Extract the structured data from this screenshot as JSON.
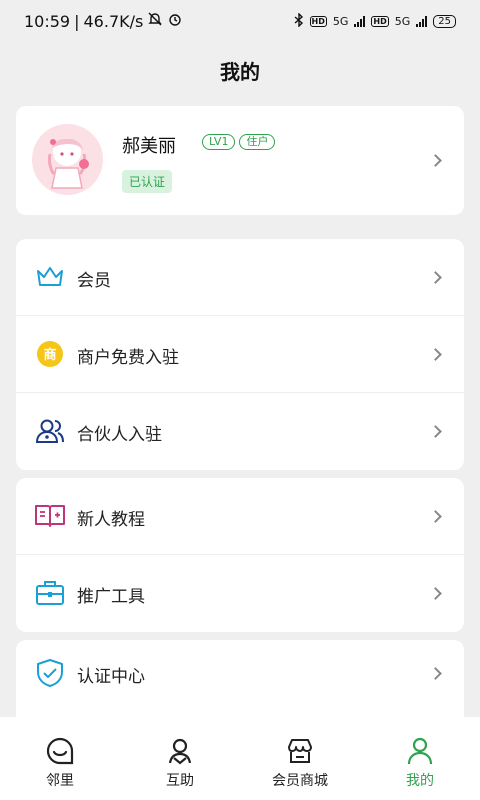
{
  "status": {
    "time": "10:59",
    "speed": "46.7K/s",
    "net1": "5G",
    "net2": "5G",
    "battery": "25"
  },
  "title": "我的",
  "profile": {
    "name": "郝美丽",
    "tags": [
      "LV1",
      "住户"
    ],
    "verified": "已认证"
  },
  "menu_group1": [
    {
      "label": "会员",
      "icon": "crown-icon"
    },
    {
      "label": "商户免费入驻",
      "icon": "merchant-icon",
      "icon_text": "商"
    },
    {
      "label": "合伙人入驻",
      "icon": "partner-icon"
    }
  ],
  "menu_group2": [
    {
      "label": "新人教程",
      "icon": "book-icon"
    },
    {
      "label": "推广工具",
      "icon": "toolbox-icon"
    }
  ],
  "menu_group3": [
    {
      "label": "认证中心",
      "icon": "shield-icon"
    }
  ],
  "tabs": [
    {
      "label": "邻里",
      "icon": "neighbor-icon"
    },
    {
      "label": "互助",
      "icon": "mutual-help-icon"
    },
    {
      "label": "会员商城",
      "icon": "store-icon"
    },
    {
      "label": "我的",
      "icon": "person-icon",
      "active": true
    }
  ],
  "colors": {
    "accent": "#2fa24f",
    "background": "#efefef",
    "merchant_yellow": "#f5c518",
    "crown_blue": "#1a9fd6",
    "book_pink": "#c0357a"
  }
}
